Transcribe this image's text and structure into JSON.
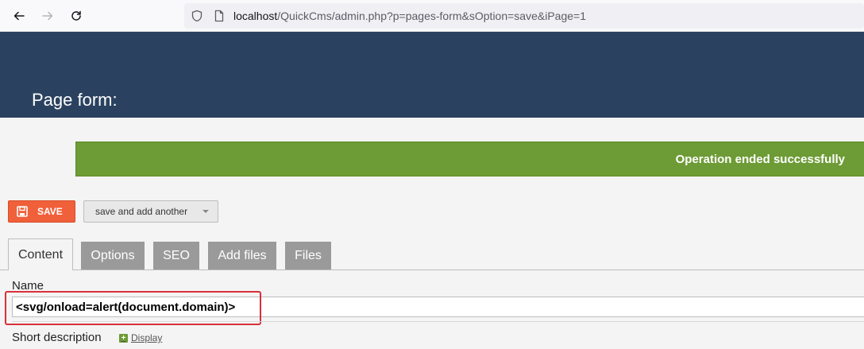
{
  "browser": {
    "url_host": "localhost",
    "url_path": "/QuickCms/admin.php?p=pages-form&sOption=save&iPage=1"
  },
  "header": {
    "title": "Page form:"
  },
  "banner": {
    "message": "Operation ended successfully"
  },
  "actions": {
    "save_label": "SAVE",
    "save_another_label": "save and add another"
  },
  "tabs": [
    {
      "label": "Content",
      "active": true
    },
    {
      "label": "Options",
      "active": false
    },
    {
      "label": "SEO",
      "active": false
    },
    {
      "label": "Add files",
      "active": false
    },
    {
      "label": "Files",
      "active": false
    }
  ],
  "form": {
    "name_label": "Name",
    "name_value": "<svg/onload=alert(document.domain)>",
    "short_description_label": "Short description",
    "display_link": "Display"
  },
  "colors": {
    "header_bg": "#2a4260",
    "banner_bg": "#6d9b35",
    "save_bg": "#f0603a",
    "highlight": "#d9303a"
  }
}
